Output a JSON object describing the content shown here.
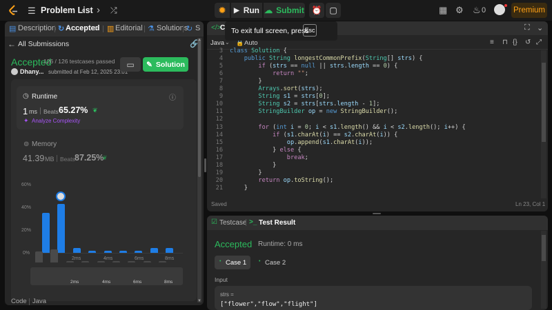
{
  "topbar": {
    "title": "Problem List",
    "run_label": "Run",
    "submit_label": "Submit",
    "notifications_count": "0",
    "premium_label": "Premium"
  },
  "left": {
    "tabs": [
      "Description",
      "Accepted",
      "Editorial",
      "Solutions",
      "S"
    ],
    "back_label": "All Submissions",
    "status": "Accepted",
    "testcases": "126 / 126 testcases passed",
    "user": "Dhany...",
    "submitted": "submitted at Feb 12, 2025 23:01",
    "solution_btn": "Solution",
    "runtime": {
      "label": "Runtime",
      "value": "1",
      "unit": "ms",
      "beats_label": "Beats",
      "beats_value": "65.27%",
      "analyze": "Analyze Complexity"
    },
    "memory": {
      "label": "Memory",
      "value": "41.39",
      "unit": "MB",
      "beats_label": "Beats",
      "beats_value": "87.25%"
    },
    "histogram": {
      "y_ticks": [
        "60%",
        "40%",
        "20%",
        "0%"
      ],
      "x_ticks": [
        "2ms",
        "4ms",
        "6ms",
        "8ms"
      ],
      "values": [
        35,
        43,
        4,
        2,
        2,
        2,
        2,
        4,
        4
      ]
    },
    "footer_code": "Code",
    "footer_lang": "Java"
  },
  "editor": {
    "tab": "Code",
    "tooltip_text": "To exit full screen, press",
    "tooltip_key": "Esc",
    "language": "Java",
    "auto_label": "Auto",
    "line_numbers": [
      "3",
      "4",
      "5",
      "6",
      "7",
      "8",
      "9",
      "10",
      "11",
      "12",
      "13",
      "14",
      "15",
      "16",
      "17",
      "18",
      "19",
      "20",
      "21"
    ],
    "saved": "Saved",
    "cursor": "Ln 23, Col 1"
  },
  "bottom": {
    "tab_testcase": "Testcase",
    "tab_result": "Test Result",
    "status": "Accepted",
    "runtime": "Runtime: 0 ms",
    "case1": "Case 1",
    "case2": "Case 2",
    "input_label": "Input",
    "param_name": "strs =",
    "param_value": "[\"flower\",\"flow\",\"flight\"]"
  },
  "colors": {
    "accent_green": "#2cbb5d",
    "premium": "#ffa116",
    "bar_blue": "#1e7de6"
  }
}
